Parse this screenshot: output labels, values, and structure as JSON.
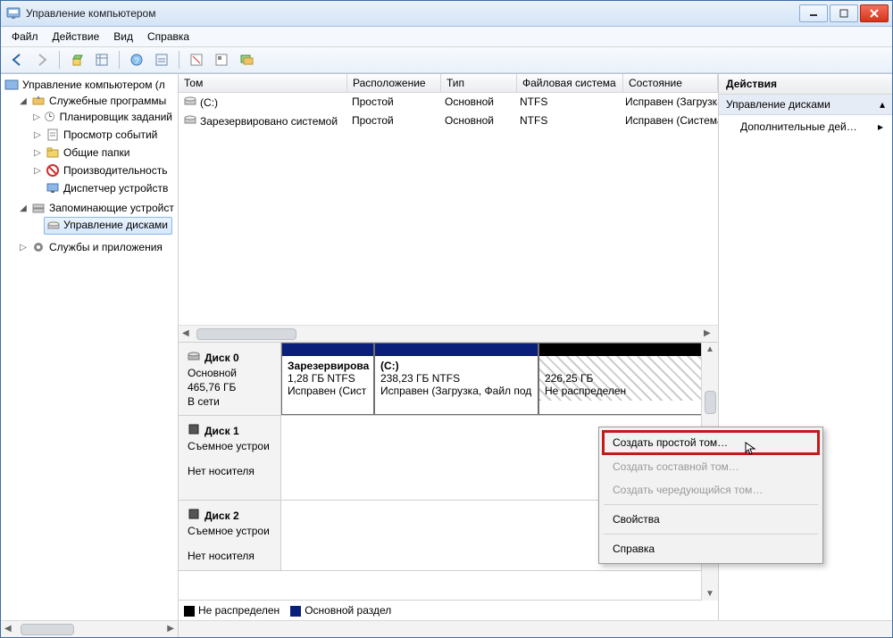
{
  "title": "Управление компьютером",
  "menu": {
    "file": "Файл",
    "action": "Действие",
    "view": "Вид",
    "help": "Справка"
  },
  "tree": {
    "root": "Управление компьютером (л",
    "tools": "Служебные программы",
    "scheduler": "Планировщик заданий",
    "events": "Просмотр событий",
    "shares": "Общие папки",
    "perf": "Производительность",
    "devmgr": "Диспетчер устройств",
    "storage": "Запоминающие устройст",
    "diskmgmt": "Управление дисками",
    "services": "Службы и приложения"
  },
  "columns": {
    "vol": "Том",
    "layout": "Расположение",
    "type": "Тип",
    "fs": "Файловая система",
    "state": "Состояние"
  },
  "volumes": [
    {
      "name": "(C:)",
      "layout": "Простой",
      "type": "Основной",
      "fs": "NTFS",
      "state": "Исправен (Загрузка, Фай"
    },
    {
      "name": "Зарезервировано системой",
      "layout": "Простой",
      "type": "Основной",
      "fs": "NTFS",
      "state": "Исправен (Система, Акти"
    }
  ],
  "disks": {
    "d0": {
      "title": "Диск 0",
      "sub1": "Основной",
      "sub2": "465,76 ГБ",
      "sub3": "В сети",
      "p1_title": "Зарезервирова",
      "p1_size": "1,28 ГБ NTFS",
      "p1_state": "Исправен (Сист",
      "p2_title": "(C:)",
      "p2_size": "238,23 ГБ NTFS",
      "p2_state": "Исправен (Загрузка, Файл под",
      "p3_size": "226,25 ГБ",
      "p3_state": "Не распределен"
    },
    "d1": {
      "title": "Диск 1",
      "sub1": "Съемное устрои",
      "sub2": "Нет носителя"
    },
    "d2": {
      "title": "Диск 2",
      "sub1": "Съемное устрои",
      "sub2": "Нет носителя"
    }
  },
  "legend": {
    "unalloc": "Не распределен",
    "primary": "Основной раздел"
  },
  "actions": {
    "head": "Действия",
    "section": "Управление дисками",
    "more": "Дополнительные дей…"
  },
  "context": {
    "simple": "Создать простой том…",
    "spanned": "Создать составной том…",
    "striped": "Создать чередующийся том…",
    "props": "Свойства",
    "help": "Справка"
  }
}
